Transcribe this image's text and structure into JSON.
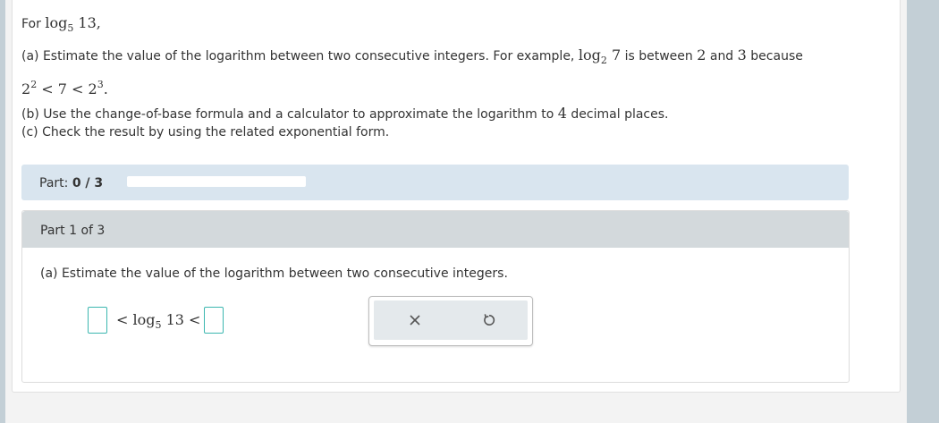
{
  "problem": {
    "intro_prefix": "For",
    "intro_log_base": "5",
    "intro_log_arg": "13",
    "intro_suffix": ",",
    "part_a_text": "(a) Estimate the value of the logarithm between two consecutive integers. For example,",
    "part_a_example_base": "2",
    "part_a_example_arg": "7",
    "part_a_between": "is between",
    "part_a_low": "2",
    "part_a_and": "and",
    "part_a_high": "3",
    "part_a_because": "because",
    "ineq_base_left": "2",
    "ineq_exp_left": "2",
    "ineq_mid": "< 7 <",
    "ineq_base_right": "2",
    "ineq_exp_right": "3",
    "ineq_end": ".",
    "part_b_text": "(b) Use the change-of-base formula and a calculator to approximate the logarithm to",
    "part_b_places": "4",
    "part_b_suffix": "decimal places.",
    "part_c_text": "(c) Check the result by using the related exponential form."
  },
  "progress": {
    "label": "Part:",
    "value": "0 / 3",
    "fraction": 0
  },
  "section": {
    "title": "Part 1 of 3",
    "question": "(a) Estimate the value of the logarithm between two consecutive integers.",
    "lt": "<",
    "log_word": "log",
    "log_base": "5",
    "log_arg": "13",
    "lt2": "<"
  },
  "tools": {
    "clear_icon": "close-icon",
    "reset_icon": "undo-icon"
  },
  "colors": {
    "accent": "#3cb7b0",
    "part_bar": "#d9e5ef",
    "section_header": "#d3d9dc"
  }
}
